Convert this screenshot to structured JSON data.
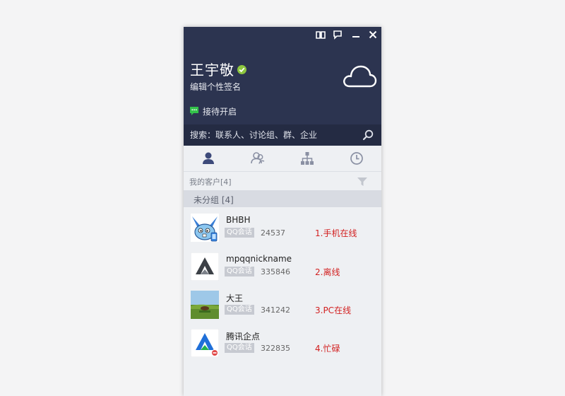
{
  "window": {
    "controls": [
      {
        "name": "book-icon"
      },
      {
        "name": "feedback-icon"
      },
      {
        "name": "minimize-icon"
      },
      {
        "name": "close-icon"
      }
    ]
  },
  "profile": {
    "name": "王宇敬",
    "signature": "编辑个性签名",
    "reception_label": "接待开启",
    "verified_color": "#8dc63f",
    "reception_icon_color": "#33c24a"
  },
  "search": {
    "placeholder": "搜索：联系人、讨论组、群、企业"
  },
  "tabs": [
    {
      "name": "tab-contacts",
      "icon": "person-icon",
      "active": true
    },
    {
      "name": "tab-customers",
      "icon": "people-icon",
      "active": false
    },
    {
      "name": "tab-organization",
      "icon": "org-chart-icon",
      "active": false
    },
    {
      "name": "tab-recent",
      "icon": "clock-icon",
      "active": false
    }
  ],
  "list": {
    "title": "我的客户[4]",
    "group_label": "未分组 [4]"
  },
  "contacts": [
    {
      "name": "BHBH",
      "badge": "QQ会话",
      "qq": "24537",
      "status": "1.手机在线",
      "avatar": "rabbit"
    },
    {
      "name": "mpqqnickname",
      "badge": "QQ会话",
      "qq": "335846",
      "status": "2.离线",
      "avatar": "logo-gray"
    },
    {
      "name": "大王",
      "badge": "QQ会话",
      "qq": "341242",
      "status": "3.PC在线",
      "avatar": "landscape"
    },
    {
      "name": "腾讯企点",
      "badge": "QQ会话",
      "qq": "322835",
      "status": "4.忙碌",
      "avatar": "logo-color"
    }
  ],
  "colors": {
    "header_bg": "#2c3450",
    "searchbar_bg": "#242b43",
    "status_red": "#d21f1f",
    "active_tab": "#3d4a7a"
  }
}
